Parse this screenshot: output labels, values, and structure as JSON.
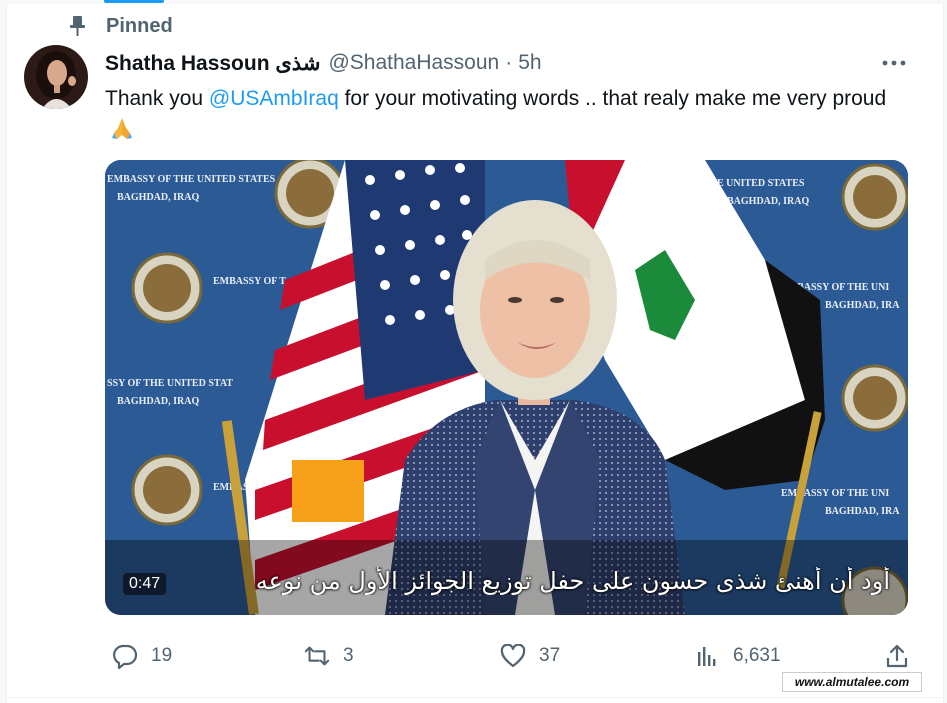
{
  "pinned": {
    "label": "Pinned",
    "icon": "pin-icon"
  },
  "author": {
    "display_name": "Shatha Hassoun شذى",
    "handle": "@ShathaHassoun",
    "separator": "·",
    "time": "5h"
  },
  "tweet": {
    "text_before": "Thank you ",
    "mention": "@USAmbIraq",
    "text_after": " for your motivating words .. that realy make me very proud",
    "emoji": "folded-hands"
  },
  "media": {
    "subtitle": "أود أن أهنئ شذى حسون على حفل توزيع الجوائز الأول من نوعه",
    "duration": "0:47",
    "backdrop_texts": {
      "embassy_us": "EMBASSY OF THE UNITED STATES",
      "baghdad": "BAGHDAD, IRAQ",
      "embassy": "EMBASSY OF T",
      "embassy_right": "EMBASSY OF THE UNI",
      "baghdad_right": "BAGHDAD, IRA",
      "ssy_us_a": "SSY OF THE UNITED STATES",
      "ssy_us_b": "SSY OF THE UNITED STAT",
      "ssy_us_right": "E UNITED STATES",
      "baghdad_right2": "BAGHDAD, IRAQ"
    }
  },
  "actions": {
    "reply_count": "19",
    "retweet_count": "3",
    "like_count": "37",
    "views_count": "6,631"
  },
  "watermark": "www.almutalee.com",
  "colors": {
    "accent": "#1d9bf0",
    "secondary_text": "#536471",
    "primary_text": "#0f1419"
  }
}
